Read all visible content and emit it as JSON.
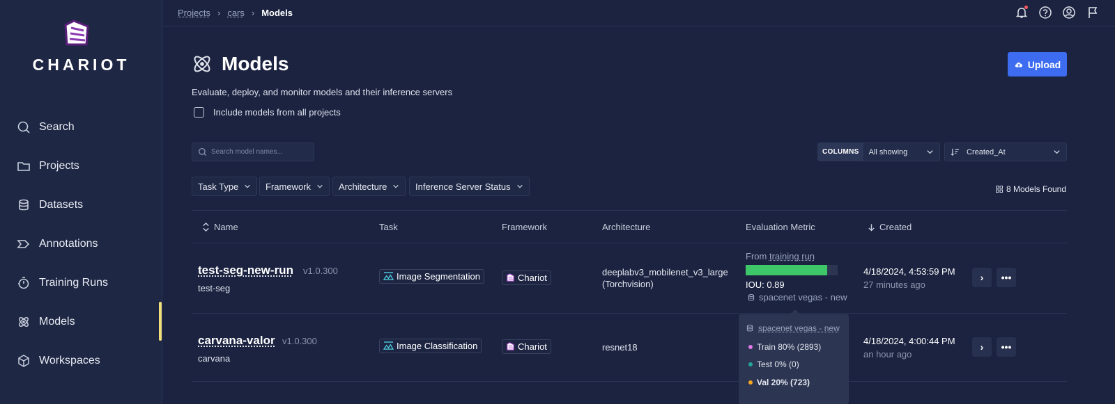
{
  "brand": {
    "name": "CHARIOT"
  },
  "sidebar": {
    "items": [
      {
        "label": "Search",
        "icon": "search-icon"
      },
      {
        "label": "Projects",
        "icon": "folder-icon"
      },
      {
        "label": "Datasets",
        "icon": "database-icon"
      },
      {
        "label": "Annotations",
        "icon": "annotations-icon"
      },
      {
        "label": "Training Runs",
        "icon": "stopwatch-icon"
      },
      {
        "label": "Models",
        "icon": "atom-icon",
        "active": true
      },
      {
        "label": "Workspaces",
        "icon": "cube-icon"
      }
    ]
  },
  "breadcrumb": {
    "items": [
      "Projects",
      "cars"
    ],
    "current": "Models"
  },
  "page": {
    "title": "Models",
    "subtitle": "Evaluate, deploy, and monitor models and their inference servers",
    "include_all_label": "Include models from all projects",
    "upload_label": "Upload"
  },
  "toolbar": {
    "search_placeholder": "Search model names...",
    "columns_label": "COLUMNS",
    "columns_value": "All showing",
    "sort_value": "Created_At",
    "filters": [
      "Task Type",
      "Framework",
      "Architecture",
      "Inference Server Status"
    ],
    "found": "8 Models Found"
  },
  "table": {
    "headers": [
      "Name",
      "Task",
      "Framework",
      "Architecture",
      "Evaluation Metric",
      "Created"
    ],
    "rows": [
      {
        "name": "test-seg-new-run",
        "version": "v1.0.300",
        "project": "test-seg",
        "task": "Image Segmentation",
        "framework": "Chariot",
        "architecture": "deeplabv3_mobilenet_v3_large",
        "architecture_sub": "(Torchvision)",
        "metric_from": "From",
        "metric_from_link": "training run",
        "metric_value": 0.89,
        "metric_label": "IOU: 0.89",
        "dataset": "spacenet vegas - new",
        "date": "4/18/2024, 4:53:59 PM",
        "ago": "27 minutes ago"
      },
      {
        "name": "carvana-valor",
        "version": "v1.0.300",
        "project": "carvana",
        "task": "Image Classification",
        "framework": "Chariot",
        "architecture": "resnet18",
        "date": "4/18/2024, 4:00:44 PM",
        "ago": "an hour ago"
      }
    ]
  },
  "tooltip": {
    "dataset": "spacenet vegas - new",
    "splits": [
      {
        "label": "Train 80% (2893)",
        "color": "#e27be8"
      },
      {
        "label": "Test 0% (0)",
        "color": "#26a69a"
      },
      {
        "label": "Val 20% (723)",
        "color": "#f5a623",
        "bold": true
      }
    ]
  },
  "colors": {
    "accent": "#3d6cf0",
    "active_marker": "#f1e07a",
    "metric_bar": "#3ec768"
  }
}
